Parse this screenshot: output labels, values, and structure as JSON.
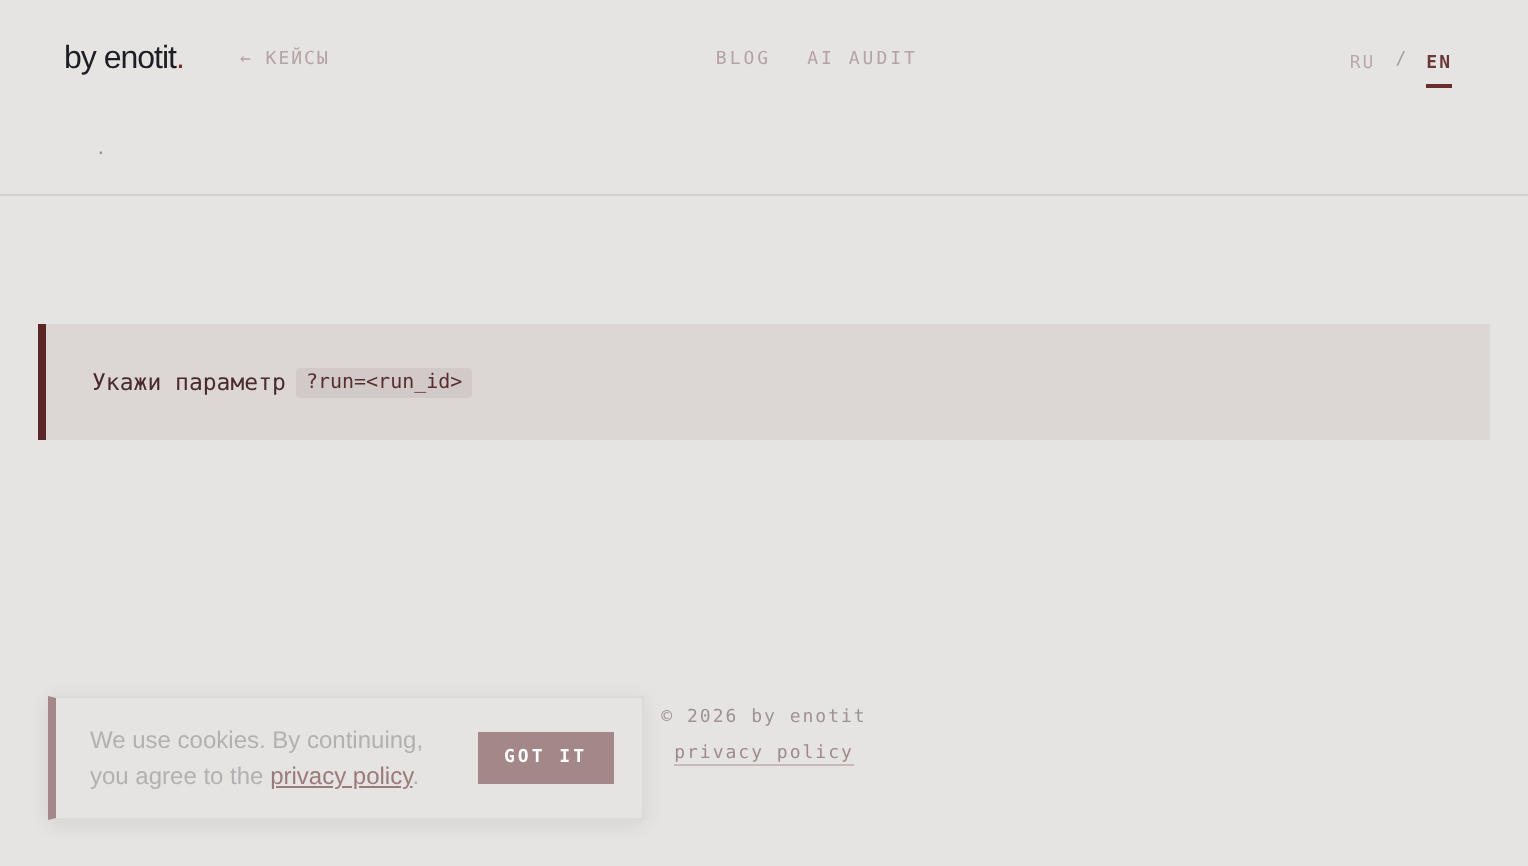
{
  "header": {
    "logo": "by enotit",
    "logo_dot": ".",
    "back_link": "← КЕЙСЫ",
    "nav": [
      {
        "label": "BLOG"
      },
      {
        "label": "AI AUDIT"
      }
    ],
    "languages": [
      {
        "label": "RU",
        "selected": false
      },
      {
        "label": "EN",
        "selected": true
      }
    ],
    "language_separator": "/"
  },
  "breadcrumb": ".",
  "notice": {
    "text": "Укажи параметр",
    "code": "?run=<run_id>"
  },
  "footer": {
    "copyright": "© 2026 by enotit",
    "link": "privacy policy"
  },
  "cookie_banner": {
    "text": "We use cookies. By continuing, you agree to the",
    "link": "privacy policy",
    "end": ".",
    "button": "GOT IT"
  }
}
